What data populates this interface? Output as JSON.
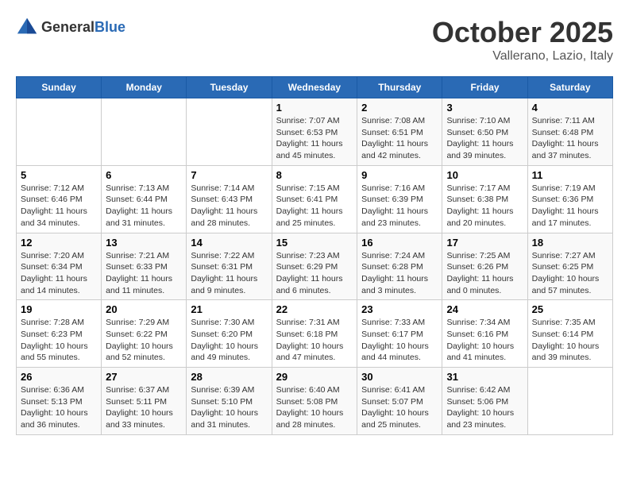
{
  "logo": {
    "text_general": "General",
    "text_blue": "Blue"
  },
  "title": {
    "month_year": "October 2025",
    "location": "Vallerano, Lazio, Italy"
  },
  "days_of_week": [
    "Sunday",
    "Monday",
    "Tuesday",
    "Wednesday",
    "Thursday",
    "Friday",
    "Saturday"
  ],
  "weeks": [
    [
      {
        "day": "",
        "info": ""
      },
      {
        "day": "",
        "info": ""
      },
      {
        "day": "",
        "info": ""
      },
      {
        "day": "1",
        "info": "Sunrise: 7:07 AM\nSunset: 6:53 PM\nDaylight: 11 hours and 45 minutes."
      },
      {
        "day": "2",
        "info": "Sunrise: 7:08 AM\nSunset: 6:51 PM\nDaylight: 11 hours and 42 minutes."
      },
      {
        "day": "3",
        "info": "Sunrise: 7:10 AM\nSunset: 6:50 PM\nDaylight: 11 hours and 39 minutes."
      },
      {
        "day": "4",
        "info": "Sunrise: 7:11 AM\nSunset: 6:48 PM\nDaylight: 11 hours and 37 minutes."
      }
    ],
    [
      {
        "day": "5",
        "info": "Sunrise: 7:12 AM\nSunset: 6:46 PM\nDaylight: 11 hours and 34 minutes."
      },
      {
        "day": "6",
        "info": "Sunrise: 7:13 AM\nSunset: 6:44 PM\nDaylight: 11 hours and 31 minutes."
      },
      {
        "day": "7",
        "info": "Sunrise: 7:14 AM\nSunset: 6:43 PM\nDaylight: 11 hours and 28 minutes."
      },
      {
        "day": "8",
        "info": "Sunrise: 7:15 AM\nSunset: 6:41 PM\nDaylight: 11 hours and 25 minutes."
      },
      {
        "day": "9",
        "info": "Sunrise: 7:16 AM\nSunset: 6:39 PM\nDaylight: 11 hours and 23 minutes."
      },
      {
        "day": "10",
        "info": "Sunrise: 7:17 AM\nSunset: 6:38 PM\nDaylight: 11 hours and 20 minutes."
      },
      {
        "day": "11",
        "info": "Sunrise: 7:19 AM\nSunset: 6:36 PM\nDaylight: 11 hours and 17 minutes."
      }
    ],
    [
      {
        "day": "12",
        "info": "Sunrise: 7:20 AM\nSunset: 6:34 PM\nDaylight: 11 hours and 14 minutes."
      },
      {
        "day": "13",
        "info": "Sunrise: 7:21 AM\nSunset: 6:33 PM\nDaylight: 11 hours and 11 minutes."
      },
      {
        "day": "14",
        "info": "Sunrise: 7:22 AM\nSunset: 6:31 PM\nDaylight: 11 hours and 9 minutes."
      },
      {
        "day": "15",
        "info": "Sunrise: 7:23 AM\nSunset: 6:29 PM\nDaylight: 11 hours and 6 minutes."
      },
      {
        "day": "16",
        "info": "Sunrise: 7:24 AM\nSunset: 6:28 PM\nDaylight: 11 hours and 3 minutes."
      },
      {
        "day": "17",
        "info": "Sunrise: 7:25 AM\nSunset: 6:26 PM\nDaylight: 11 hours and 0 minutes."
      },
      {
        "day": "18",
        "info": "Sunrise: 7:27 AM\nSunset: 6:25 PM\nDaylight: 10 hours and 57 minutes."
      }
    ],
    [
      {
        "day": "19",
        "info": "Sunrise: 7:28 AM\nSunset: 6:23 PM\nDaylight: 10 hours and 55 minutes."
      },
      {
        "day": "20",
        "info": "Sunrise: 7:29 AM\nSunset: 6:22 PM\nDaylight: 10 hours and 52 minutes."
      },
      {
        "day": "21",
        "info": "Sunrise: 7:30 AM\nSunset: 6:20 PM\nDaylight: 10 hours and 49 minutes."
      },
      {
        "day": "22",
        "info": "Sunrise: 7:31 AM\nSunset: 6:18 PM\nDaylight: 10 hours and 47 minutes."
      },
      {
        "day": "23",
        "info": "Sunrise: 7:33 AM\nSunset: 6:17 PM\nDaylight: 10 hours and 44 minutes."
      },
      {
        "day": "24",
        "info": "Sunrise: 7:34 AM\nSunset: 6:16 PM\nDaylight: 10 hours and 41 minutes."
      },
      {
        "day": "25",
        "info": "Sunrise: 7:35 AM\nSunset: 6:14 PM\nDaylight: 10 hours and 39 minutes."
      }
    ],
    [
      {
        "day": "26",
        "info": "Sunrise: 6:36 AM\nSunset: 5:13 PM\nDaylight: 10 hours and 36 minutes."
      },
      {
        "day": "27",
        "info": "Sunrise: 6:37 AM\nSunset: 5:11 PM\nDaylight: 10 hours and 33 minutes."
      },
      {
        "day": "28",
        "info": "Sunrise: 6:39 AM\nSunset: 5:10 PM\nDaylight: 10 hours and 31 minutes."
      },
      {
        "day": "29",
        "info": "Sunrise: 6:40 AM\nSunset: 5:08 PM\nDaylight: 10 hours and 28 minutes."
      },
      {
        "day": "30",
        "info": "Sunrise: 6:41 AM\nSunset: 5:07 PM\nDaylight: 10 hours and 25 minutes."
      },
      {
        "day": "31",
        "info": "Sunrise: 6:42 AM\nSunset: 5:06 PM\nDaylight: 10 hours and 23 minutes."
      },
      {
        "day": "",
        "info": ""
      }
    ]
  ]
}
